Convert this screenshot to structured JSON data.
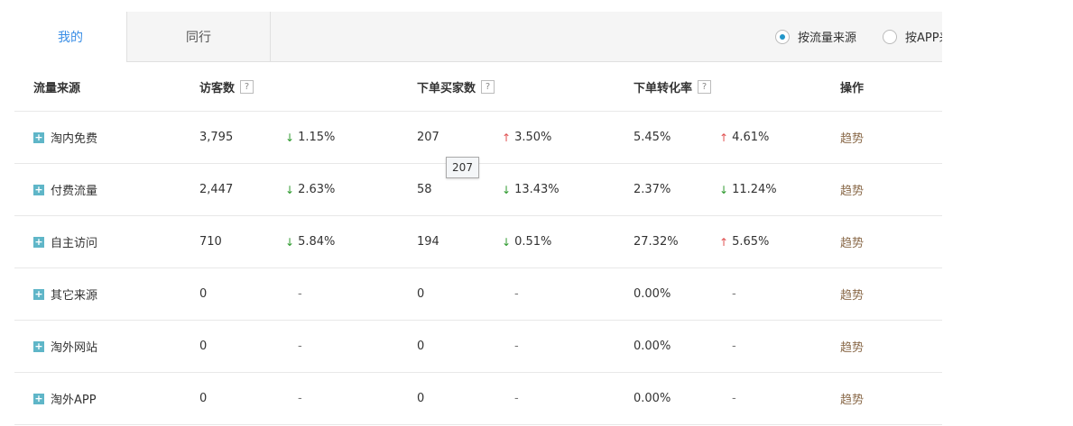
{
  "tabs": {
    "mine": "我的",
    "peers": "同行"
  },
  "radios": [
    {
      "label": "按流量来源",
      "selected": true
    },
    {
      "label": "按APP来",
      "selected": false
    }
  ],
  "header": {
    "source": "流量来源",
    "visitors": "访客数",
    "buyers": "下单买家数",
    "conversion": "下单转化率",
    "action": "操作",
    "help_icon": "?"
  },
  "rows": [
    {
      "source": "淘内免费",
      "visitors": "3,795",
      "visitors_change": "1.15%",
      "visitors_dir": "down",
      "buyers": "207",
      "buyers_change": "3.50%",
      "buyers_dir": "up",
      "conversion": "5.45%",
      "conversion_change": "4.61%",
      "conversion_dir": "up",
      "action": "趋势"
    },
    {
      "source": "付费流量",
      "visitors": "2,447",
      "visitors_change": "2.63%",
      "visitors_dir": "down",
      "buyers": "58",
      "buyers_change": "13.43%",
      "buyers_dir": "down",
      "conversion": "2.37%",
      "conversion_change": "11.24%",
      "conversion_dir": "down",
      "action": "趋势"
    },
    {
      "source": "自主访问",
      "visitors": "710",
      "visitors_change": "5.84%",
      "visitors_dir": "down",
      "buyers": "194",
      "buyers_change": "0.51%",
      "buyers_dir": "down",
      "conversion": "27.32%",
      "conversion_change": "5.65%",
      "conversion_dir": "up",
      "action": "趋势"
    },
    {
      "source": "其它来源",
      "visitors": "0",
      "visitors_change": "-",
      "visitors_dir": "none",
      "buyers": "0",
      "buyers_change": "-",
      "buyers_dir": "none",
      "conversion": "0.00%",
      "conversion_change": "-",
      "conversion_dir": "none",
      "action": "趋势"
    },
    {
      "source": "淘外网站",
      "visitors": "0",
      "visitors_change": "-",
      "visitors_dir": "none",
      "buyers": "0",
      "buyers_change": "-",
      "buyers_dir": "none",
      "conversion": "0.00%",
      "conversion_change": "-",
      "conversion_dir": "none",
      "action": "趋势"
    },
    {
      "source": "淘外APP",
      "visitors": "0",
      "visitors_change": "-",
      "visitors_dir": "none",
      "buyers": "0",
      "buyers_change": "-",
      "buyers_dir": "none",
      "conversion": "0.00%",
      "conversion_change": "-",
      "conversion_dir": "none",
      "action": "趋势"
    }
  ],
  "tooltip": "207",
  "colors": {
    "accent": "#3a8ee6",
    "down": "#2e9a2e",
    "up": "#e05050",
    "link": "#8a6a4a",
    "expand": "#5fb6c8"
  }
}
